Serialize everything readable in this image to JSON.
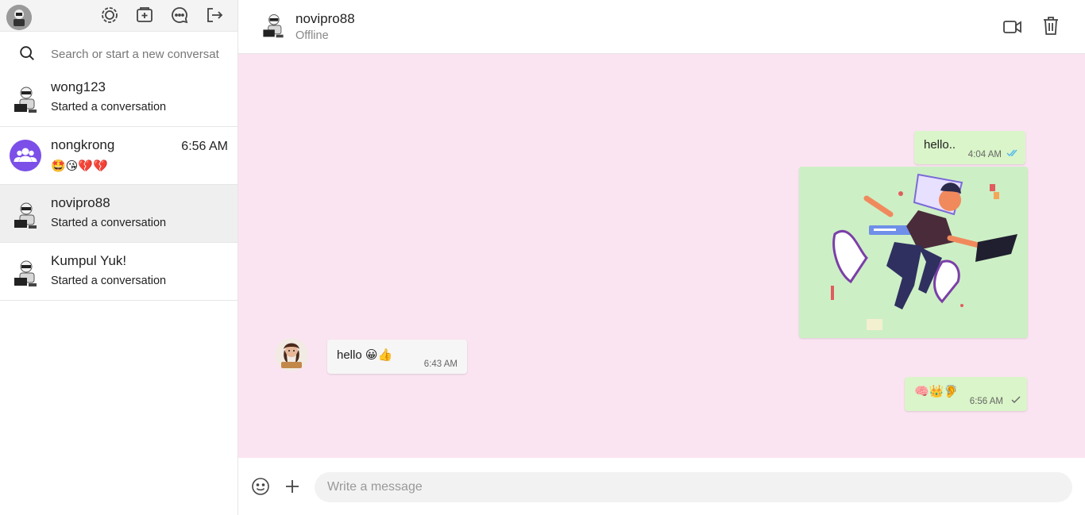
{
  "sidebar": {
    "search_placeholder": "Search or start a new conversat",
    "conversations": [
      {
        "name": "wong123",
        "preview": "Started a conversation",
        "time": ""
      },
      {
        "name": "nongkrong",
        "preview": "🤩😘💔💔",
        "time": "6:56 AM"
      },
      {
        "name": "novipro88",
        "preview": "Started a conversation",
        "time": ""
      },
      {
        "name": "Kumpul Yuk!",
        "preview": "Started a conversation",
        "time": ""
      }
    ],
    "header_icons": [
      "status-icon",
      "new-chat-icon",
      "community-icon",
      "logout-icon"
    ]
  },
  "chat": {
    "contact_name": "novipro88",
    "contact_status": "Offline",
    "messages": [
      {
        "direction": "out",
        "text": "hello..",
        "time": "4:04 AM",
        "status": "read"
      },
      {
        "direction": "out",
        "type": "image",
        "time": ""
      },
      {
        "direction": "in",
        "text": "hello 😀👍",
        "time": "6:43 AM"
      },
      {
        "direction": "out",
        "text": "🧠👑🦻",
        "time": "6:56 AM",
        "status": "sent"
      }
    ]
  },
  "composer": {
    "placeholder": "Write a message"
  },
  "colors": {
    "chat_background": "#fbe4f1",
    "outgoing_bubble": "#daf5c9",
    "incoming_bubble": "#f6f6f6",
    "read_tick": "#4fb6ec",
    "group_avatar": "#7b4fe8"
  }
}
